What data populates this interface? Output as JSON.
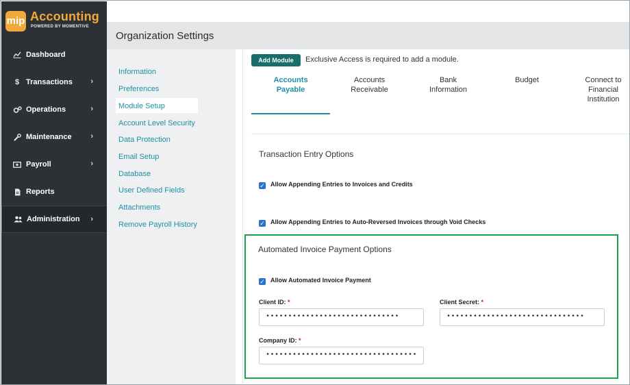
{
  "app": {
    "logo_badge": "mip",
    "logo_title": "Accounting",
    "logo_subtitle": "POWERED BY MOMENTIVE"
  },
  "sidebar": {
    "items": [
      {
        "label": "Dashboard",
        "icon": "chart-line-icon",
        "has_chevron": false
      },
      {
        "label": "Transactions",
        "icon": "dollar-icon",
        "has_chevron": true
      },
      {
        "label": "Operations",
        "icon": "gears-icon",
        "has_chevron": true
      },
      {
        "label": "Maintenance",
        "icon": "wrench-icon",
        "has_chevron": true
      },
      {
        "label": "Payroll",
        "icon": "money-bill-icon",
        "has_chevron": true
      },
      {
        "label": "Reports",
        "icon": "document-icon",
        "has_chevron": false
      },
      {
        "label": "Administration",
        "icon": "users-icon",
        "has_chevron": true,
        "active": true
      }
    ]
  },
  "header": {
    "title": "Organization Settings"
  },
  "submenu": {
    "items": [
      "Information",
      "Preferences",
      "Module Setup",
      "Account Level Security",
      "Data Protection",
      "Email Setup",
      "Database",
      "User Defined Fields",
      "Attachments",
      "Remove Payroll History"
    ],
    "selected": "Module Setup"
  },
  "toolbar": {
    "add_module_label": "Add Module",
    "add_module_note": "Exclusive Access is required to add a module."
  },
  "tabs": [
    {
      "line1": "Accounts",
      "line2": "Payable",
      "line3": "",
      "active": true
    },
    {
      "line1": "Accounts",
      "line2": "Receivable",
      "line3": "",
      "active": false
    },
    {
      "line1": "Bank",
      "line2": "Information",
      "line3": "",
      "active": false
    },
    {
      "line1": "Budget",
      "line2": "",
      "line3": "",
      "active": false
    },
    {
      "line1": "Connect to",
      "line2": "Financial",
      "line3": "Institution",
      "active": false
    }
  ],
  "transaction_entry": {
    "title": "Transaction Entry Options",
    "options": [
      {
        "label": "Allow Appending Entries to Invoices and Credits",
        "checked": true
      },
      {
        "label": "Allow Appending Entries to Auto-Reversed Invoices through Void Checks",
        "checked": true
      }
    ]
  },
  "automated_payment": {
    "title": "Automated Invoice Payment Options",
    "allow_label": "Allow Automated Invoice Payment",
    "allow_checked": true,
    "client_id_label": "Client ID:",
    "client_id_value": "••••••••••••••••••••••••••••••",
    "client_secret_label": "Client Secret:",
    "client_secret_value": "•••••••••••••••••••••••••••••••",
    "company_id_label": "Company ID:",
    "company_id_value": "••••••••••••••••••••••••••••••••••",
    "required_mark": "*"
  },
  "colors": {
    "sidebar_bg": "#2d3135",
    "accent_teal": "#1f8fa6",
    "button_bg": "#176e6a",
    "highlight_green": "#1aa34a",
    "logo_orange": "#f2a93b",
    "checkbox_blue": "#2a73c9"
  }
}
